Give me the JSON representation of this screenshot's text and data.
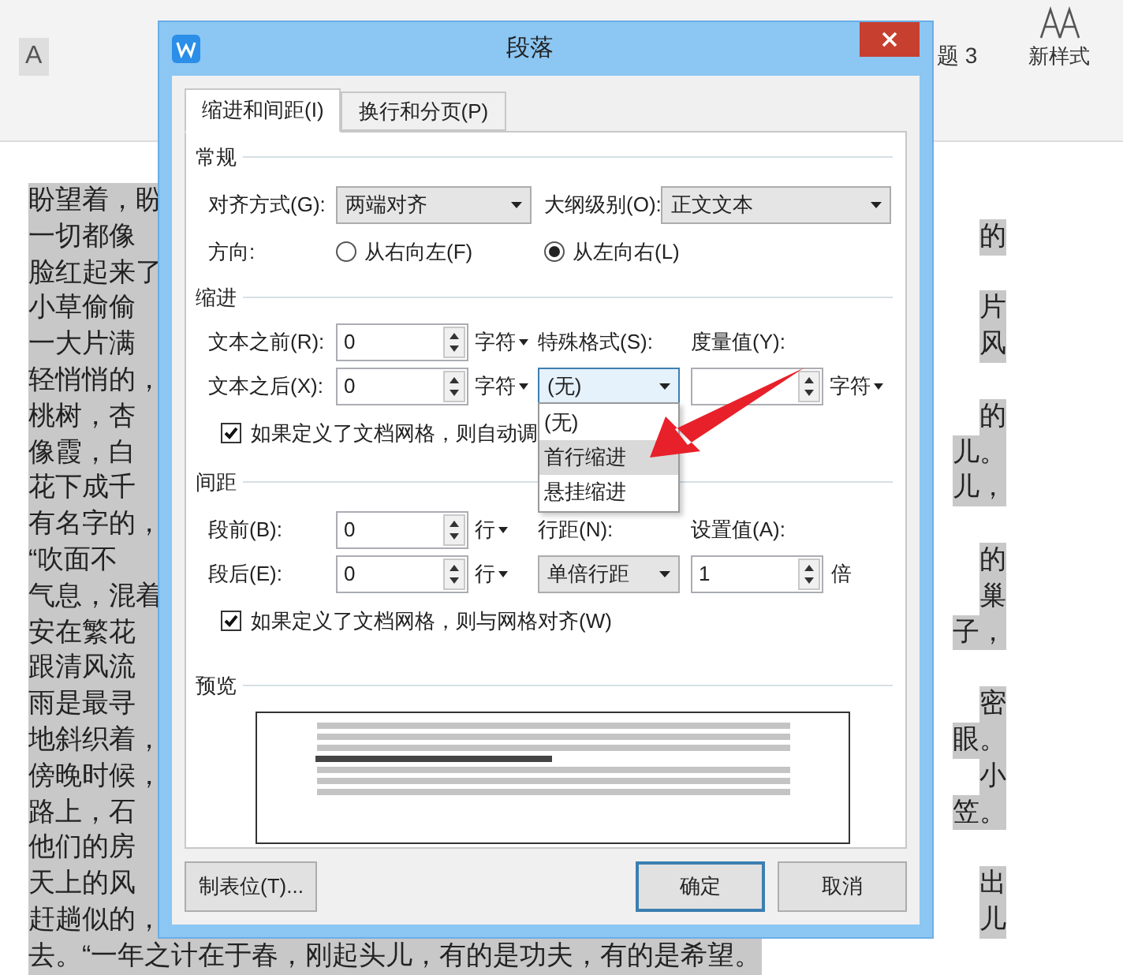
{
  "ribbon": {
    "font_button": "A",
    "style_label": "题 3",
    "new_style": "新样式"
  },
  "document": {
    "lines": [
      {
        "start": "盼望着，盼"
      },
      {
        "start": "一切都像",
        "end": "的"
      },
      {
        "start": "脸红起来了"
      },
      {
        "start": "小草偷偷",
        "end": "片"
      },
      {
        "start": "一大片满",
        "end": "风"
      },
      {
        "start": "轻悄悄的，"
      },
      {
        "start": "桃树，杏",
        "end": "的"
      },
      {
        "start": "像霞，白",
        "end": "儿。"
      },
      {
        "start": "花下成千",
        "end": "儿，"
      },
      {
        "start": "有名字的，"
      },
      {
        "start": "“吹面不",
        "end": "的"
      },
      {
        "start": "气息，混着",
        "end": "巢"
      },
      {
        "start": "安在繁花",
        "end": "子，"
      },
      {
        "start": "跟清风流"
      },
      {
        "start": "雨是最寻",
        "end": "密"
      },
      {
        "start": "地斜织着，",
        "end": "眼。"
      },
      {
        "start": "傍晚时候，",
        "end": "小"
      },
      {
        "start": "路上，石",
        "end": "笠。"
      },
      {
        "start": "他们的房"
      },
      {
        "start": "天上的风",
        "end": "出"
      },
      {
        "start": "赶趟似的，",
        "end": "儿"
      }
    ],
    "last_line": "去。“一年之计在于春，刚起头儿，有的是功夫，有的是希望。"
  },
  "dialog": {
    "title": "段落",
    "tabs": [
      {
        "label": "缩进和间距(I)",
        "selected": true
      },
      {
        "label": "换行和分页(P)",
        "selected": false
      }
    ],
    "general": {
      "heading": "常规",
      "alignment_label": "对齐方式(G):",
      "alignment": "两端对齐",
      "outline_label": "大纲级别(O):",
      "outline": "正文文本",
      "direction_label": "方向:",
      "directions": [
        {
          "label": "从右向左(F)",
          "selected": false
        },
        {
          "label": "从左向右(L)",
          "selected": true
        }
      ]
    },
    "indent": {
      "heading": "缩进",
      "before_label": "文本之前(R):",
      "before": "0",
      "before_unit": "字符",
      "after_label": "文本之后(X):",
      "after": "0",
      "after_unit": "字符",
      "special_label": "特殊格式(S):",
      "special": "(无)",
      "measure_label": "度量值(Y):",
      "measure_unit": "字符",
      "special_options": [
        {
          "label": "(无)",
          "selected": false
        },
        {
          "label": "首行缩进",
          "selected": true
        },
        {
          "label": "悬挂缩进",
          "selected": false
        }
      ],
      "grid_check": {
        "label": "如果定义了文档网格，则自动调",
        "checked": true
      }
    },
    "spacing": {
      "heading": "间距",
      "before_label": "段前(B):",
      "before": "0",
      "before_unit": "行",
      "after_label": "段后(E):",
      "after": "0",
      "after_unit": "行",
      "line_label": "行距(N):",
      "line": "单倍行距",
      "value_label": "设置值(A):",
      "value": "1",
      "value_unit": "倍",
      "grid_check": {
        "label": "如果定义了文档网格，则与网格对齐(W)",
        "checked": true
      }
    },
    "preview_heading": "预览",
    "buttons": [
      {
        "label": "制表位(T)...",
        "kind": "tabs"
      },
      {
        "label": "确定",
        "kind": "default"
      },
      {
        "label": "取消",
        "kind": "normal"
      }
    ]
  }
}
